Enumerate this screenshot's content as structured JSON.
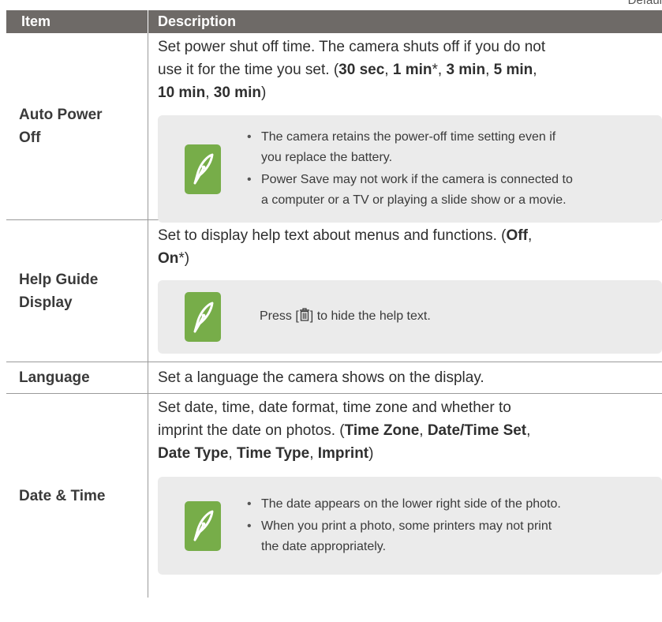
{
  "corner_label": "Defaul",
  "header": {
    "item": "Item",
    "description": "Description"
  },
  "rows": [
    {
      "item_line1": "Auto Power",
      "item_line2": "Off",
      "desc": {
        "l1": "Set power shut off time. The camera shuts off if you do not",
        "l2": "use it for the time you set. (",
        "o1": "30 sec",
        "o2": "1 min",
        "o3": "3 min",
        "o4": "5 min",
        "o5": "10 min",
        "o6": "30 min",
        "star": "*",
        "sep": ", ",
        "sep_end": ",",
        "close": ")"
      },
      "note": {
        "icon": "pen-note-icon",
        "b1_l1": "The camera retains the power-off time setting even if",
        "b1_l2": "you replace the battery.",
        "b2_l1": "Power Save may not work if the camera is connected to",
        "b2_l2": "a computer or a TV or playing a slide show or a movie."
      }
    },
    {
      "item_line1": "Help Guide",
      "item_line2": "Display",
      "desc": {
        "l1": "Set to display help text about menus and functions. (",
        "o1": "Off",
        "sep_end": ",",
        "o2": "On",
        "star": "*",
        "close": ")"
      },
      "note": {
        "icon": "pen-note-icon",
        "pre": "Press [",
        "trash_icon": "trash-icon",
        "post": "] to hide the help text."
      }
    },
    {
      "item": "Language",
      "desc": {
        "l1": "Set a language the camera shows on the display."
      }
    },
    {
      "item": "Date & Time",
      "desc": {
        "l1": "Set date, time, date format, time zone and whether to",
        "l2": "imprint the date on photos. (",
        "o1": "Time Zone",
        "o2": "Date/Time Set",
        "o3": "Date Type",
        "o4": "Time Type",
        "o5": "Imprint",
        "sep": ", ",
        "sep_end": ",",
        "close": ")"
      },
      "note": {
        "icon": "pen-note-icon",
        "b1_l1": "The date appears on the lower right side of the photo.",
        "b2_l1": "When you print a photo, some printers may not print",
        "b2_l2": "the date appropriately."
      }
    }
  ]
}
